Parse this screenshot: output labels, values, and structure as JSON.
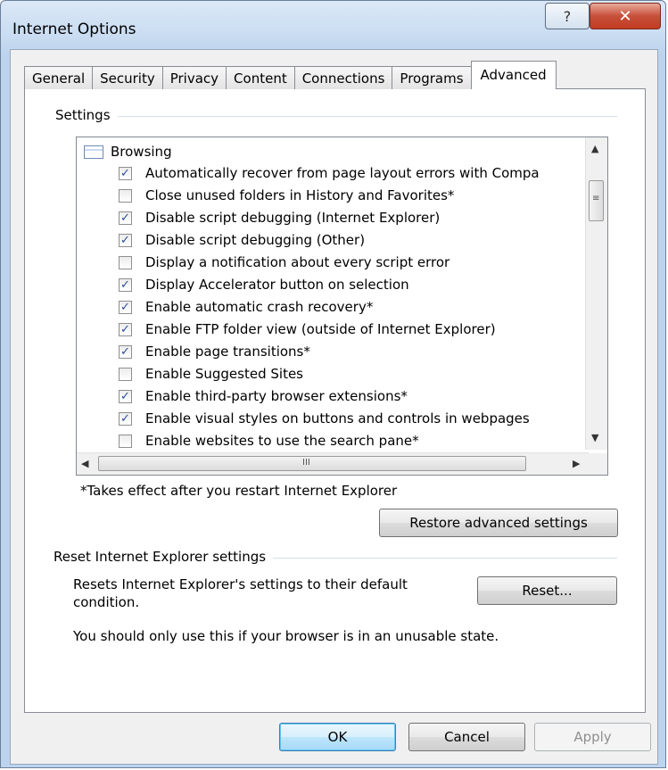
{
  "window": {
    "title": "Internet Options",
    "help_glyph": "?",
    "close_glyph": "✕"
  },
  "tabs": [
    "General",
    "Security",
    "Privacy",
    "Content",
    "Connections",
    "Programs",
    "Advanced"
  ],
  "active_tab": "Advanced",
  "settings_group": {
    "label": "Settings",
    "root_label": "Browsing",
    "items": [
      {
        "label": "Automatically recover from page layout errors with Compa",
        "checked": true
      },
      {
        "label": "Close unused folders in History and Favorites*",
        "checked": false
      },
      {
        "label": "Disable script debugging (Internet Explorer)",
        "checked": true
      },
      {
        "label": "Disable script debugging (Other)",
        "checked": true
      },
      {
        "label": "Display a notification about every script error",
        "checked": false
      },
      {
        "label": "Display Accelerator button on selection",
        "checked": true
      },
      {
        "label": "Enable automatic crash recovery*",
        "checked": true
      },
      {
        "label": "Enable FTP folder view (outside of Internet Explorer)",
        "checked": true
      },
      {
        "label": "Enable page transitions*",
        "checked": true
      },
      {
        "label": "Enable Suggested Sites",
        "checked": false
      },
      {
        "label": "Enable third-party browser extensions*",
        "checked": true
      },
      {
        "label": "Enable visual styles on buttons and controls in webpages",
        "checked": true
      },
      {
        "label": "Enable websites to use the search pane*",
        "checked": false
      }
    ],
    "check_glyph": "✓",
    "restart_note": "*Takes effect after you restart Internet Explorer",
    "restore_button": "Restore advanced settings"
  },
  "reset_group": {
    "label": "Reset Internet Explorer settings",
    "description_line1": "Resets Internet Explorer's settings to their default",
    "description_line2": "condition.",
    "reset_button": "Reset...",
    "warning": "You should only use this if your browser is in an unusable state."
  },
  "footer": {
    "ok": "OK",
    "cancel": "Cancel",
    "apply": "Apply"
  },
  "scrollbar_glyphs": {
    "up": "▲",
    "down": "▼",
    "left": "◀",
    "right": "▶",
    "v_grip": "≡",
    "h_grip": "III"
  }
}
